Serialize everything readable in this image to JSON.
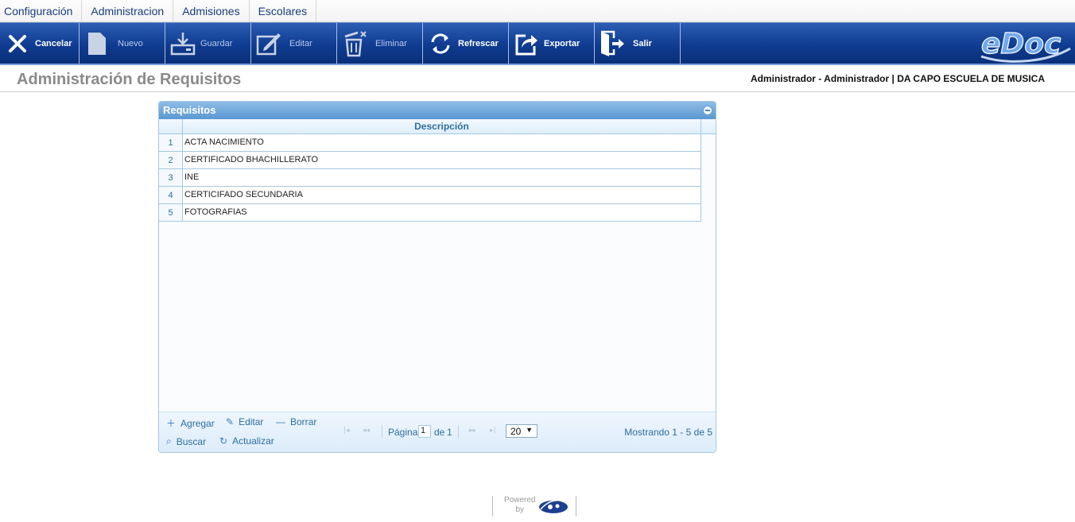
{
  "menu": [
    {
      "label": "Configuración"
    },
    {
      "label": "Administracion"
    },
    {
      "label": "Admisiones"
    },
    {
      "label": "Escolares"
    }
  ],
  "toolbar": [
    {
      "label": "Cancelar",
      "icon": "close-icon",
      "enabled": true
    },
    {
      "label": "Nuevo",
      "icon": "new-document-icon",
      "enabled": false
    },
    {
      "label": "Guardar",
      "icon": "save-icon",
      "enabled": false
    },
    {
      "label": "Editar",
      "icon": "edit-icon",
      "enabled": false
    },
    {
      "label": "Eliminar",
      "icon": "trash-icon",
      "enabled": false
    },
    {
      "label": "Refrescar",
      "icon": "refresh-icon",
      "enabled": true
    },
    {
      "label": "Exportar",
      "icon": "export-icon",
      "enabled": true
    },
    {
      "label": "Salir",
      "icon": "exit-icon",
      "enabled": true
    }
  ],
  "brand": {
    "logo_text": "eDoc"
  },
  "page": {
    "title": "Administración de Requisitos",
    "user_info": "Administrador - Administrador | DA CAPO ESCUELA DE MUSICA"
  },
  "grid": {
    "caption": "Requisitos",
    "column_header": "Descripción",
    "rows": [
      {
        "num": "1",
        "desc": "ACTA NACIMIENTO"
      },
      {
        "num": "2",
        "desc": "CERTIFICADO BHACHILLERATO"
      },
      {
        "num": "3",
        "desc": "INE"
      },
      {
        "num": "4",
        "desc": "CERTICIFADO SECUNDARIA"
      },
      {
        "num": "5",
        "desc": "FOTOGRAFIAS"
      }
    ],
    "actions": {
      "add": "Agregar",
      "edit": "Editar",
      "delete": "Borrar",
      "search": "Buscar",
      "refresh": "Actualizar"
    },
    "pager": {
      "page_label": "Página",
      "page_value": "1",
      "of_label": "de",
      "total_pages": "1",
      "rows_per_page": "20",
      "showing": "Mostrando 1 - 5 de 5"
    }
  },
  "footer": {
    "powered_line1": "Powered",
    "powered_line2": "by"
  },
  "colors": {
    "toolbar_blue": "#1b4aa0",
    "grid_header": "#5a98d2",
    "title_gray": "#8a8a8a"
  }
}
